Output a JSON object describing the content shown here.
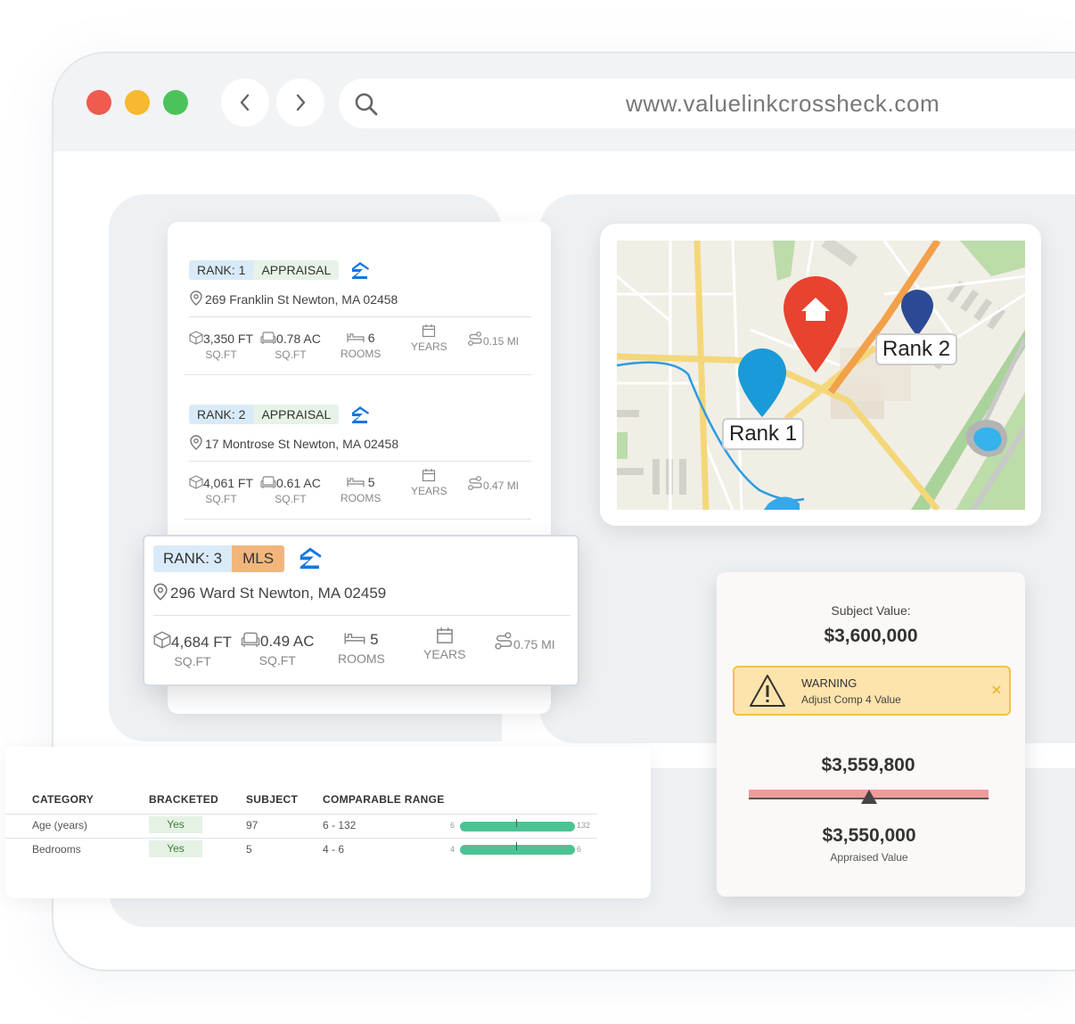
{
  "browser": {
    "url": "www.valuelinkcrossheck.com",
    "dots": [
      "#f05a4f",
      "#f7b92f",
      "#4cc35a"
    ]
  },
  "listings": [
    {
      "rank": "RANK: 1",
      "source": "APPRAISAL",
      "address": "269 Franklin St Newton, MA 02458",
      "sqft": "3,350 FT",
      "sqft_label": "SQ.FT",
      "acres": "0.78 AC",
      "acres_label": "SQ.FT",
      "rooms": "6",
      "rooms_label": "ROOMS",
      "years_label": "YEARS",
      "distance": "0.15 MI"
    },
    {
      "rank": "RANK: 2",
      "source": "APPRAISAL",
      "address": "17 Montrose St Newton, MA 02458",
      "sqft": "4,061 FT",
      "sqft_label": "SQ.FT",
      "acres": "0.61 AC",
      "acres_label": "SQ.FT",
      "rooms": "5",
      "rooms_label": "ROOMS",
      "years_label": "YEARS",
      "distance": "0.47 MI"
    },
    {
      "rank": "RANK: 3",
      "source": "MLS",
      "address": "296 Ward St Newton, MA 02459",
      "sqft": "4,684 FT",
      "sqft_label": "SQ.FT",
      "acres": "0.49 AC",
      "acres_label": "SQ.FT",
      "rooms": "5",
      "rooms_label": "ROOMS",
      "years_label": "YEARS",
      "distance": "0.75 MI"
    }
  ],
  "map": {
    "pin1": "Rank 1",
    "pin2": "Rank 2"
  },
  "valuation": {
    "subject_label": "Subject Value:",
    "subject_value": "$3,600,000",
    "warning_title": "WARNING",
    "warning_text": "Adjust Comp 4 Value",
    "estimate": "$3,559,800",
    "appraised_value": "$3,550,000",
    "appraised_label": "Appraised Value"
  },
  "table": {
    "headers": [
      "CATEGORY",
      "BRACKETED",
      "SUBJECT",
      "COMPARABLE RANGE"
    ],
    "rows": [
      {
        "category": "Age (years)",
        "bracketed": "Yes",
        "subject": "97",
        "range": "6 - 132",
        "min": "6",
        "max": "132"
      },
      {
        "category": "Bedrooms",
        "bracketed": "Yes",
        "subject": "5",
        "range": "4 - 6",
        "min": "4",
        "max": "6"
      }
    ]
  }
}
